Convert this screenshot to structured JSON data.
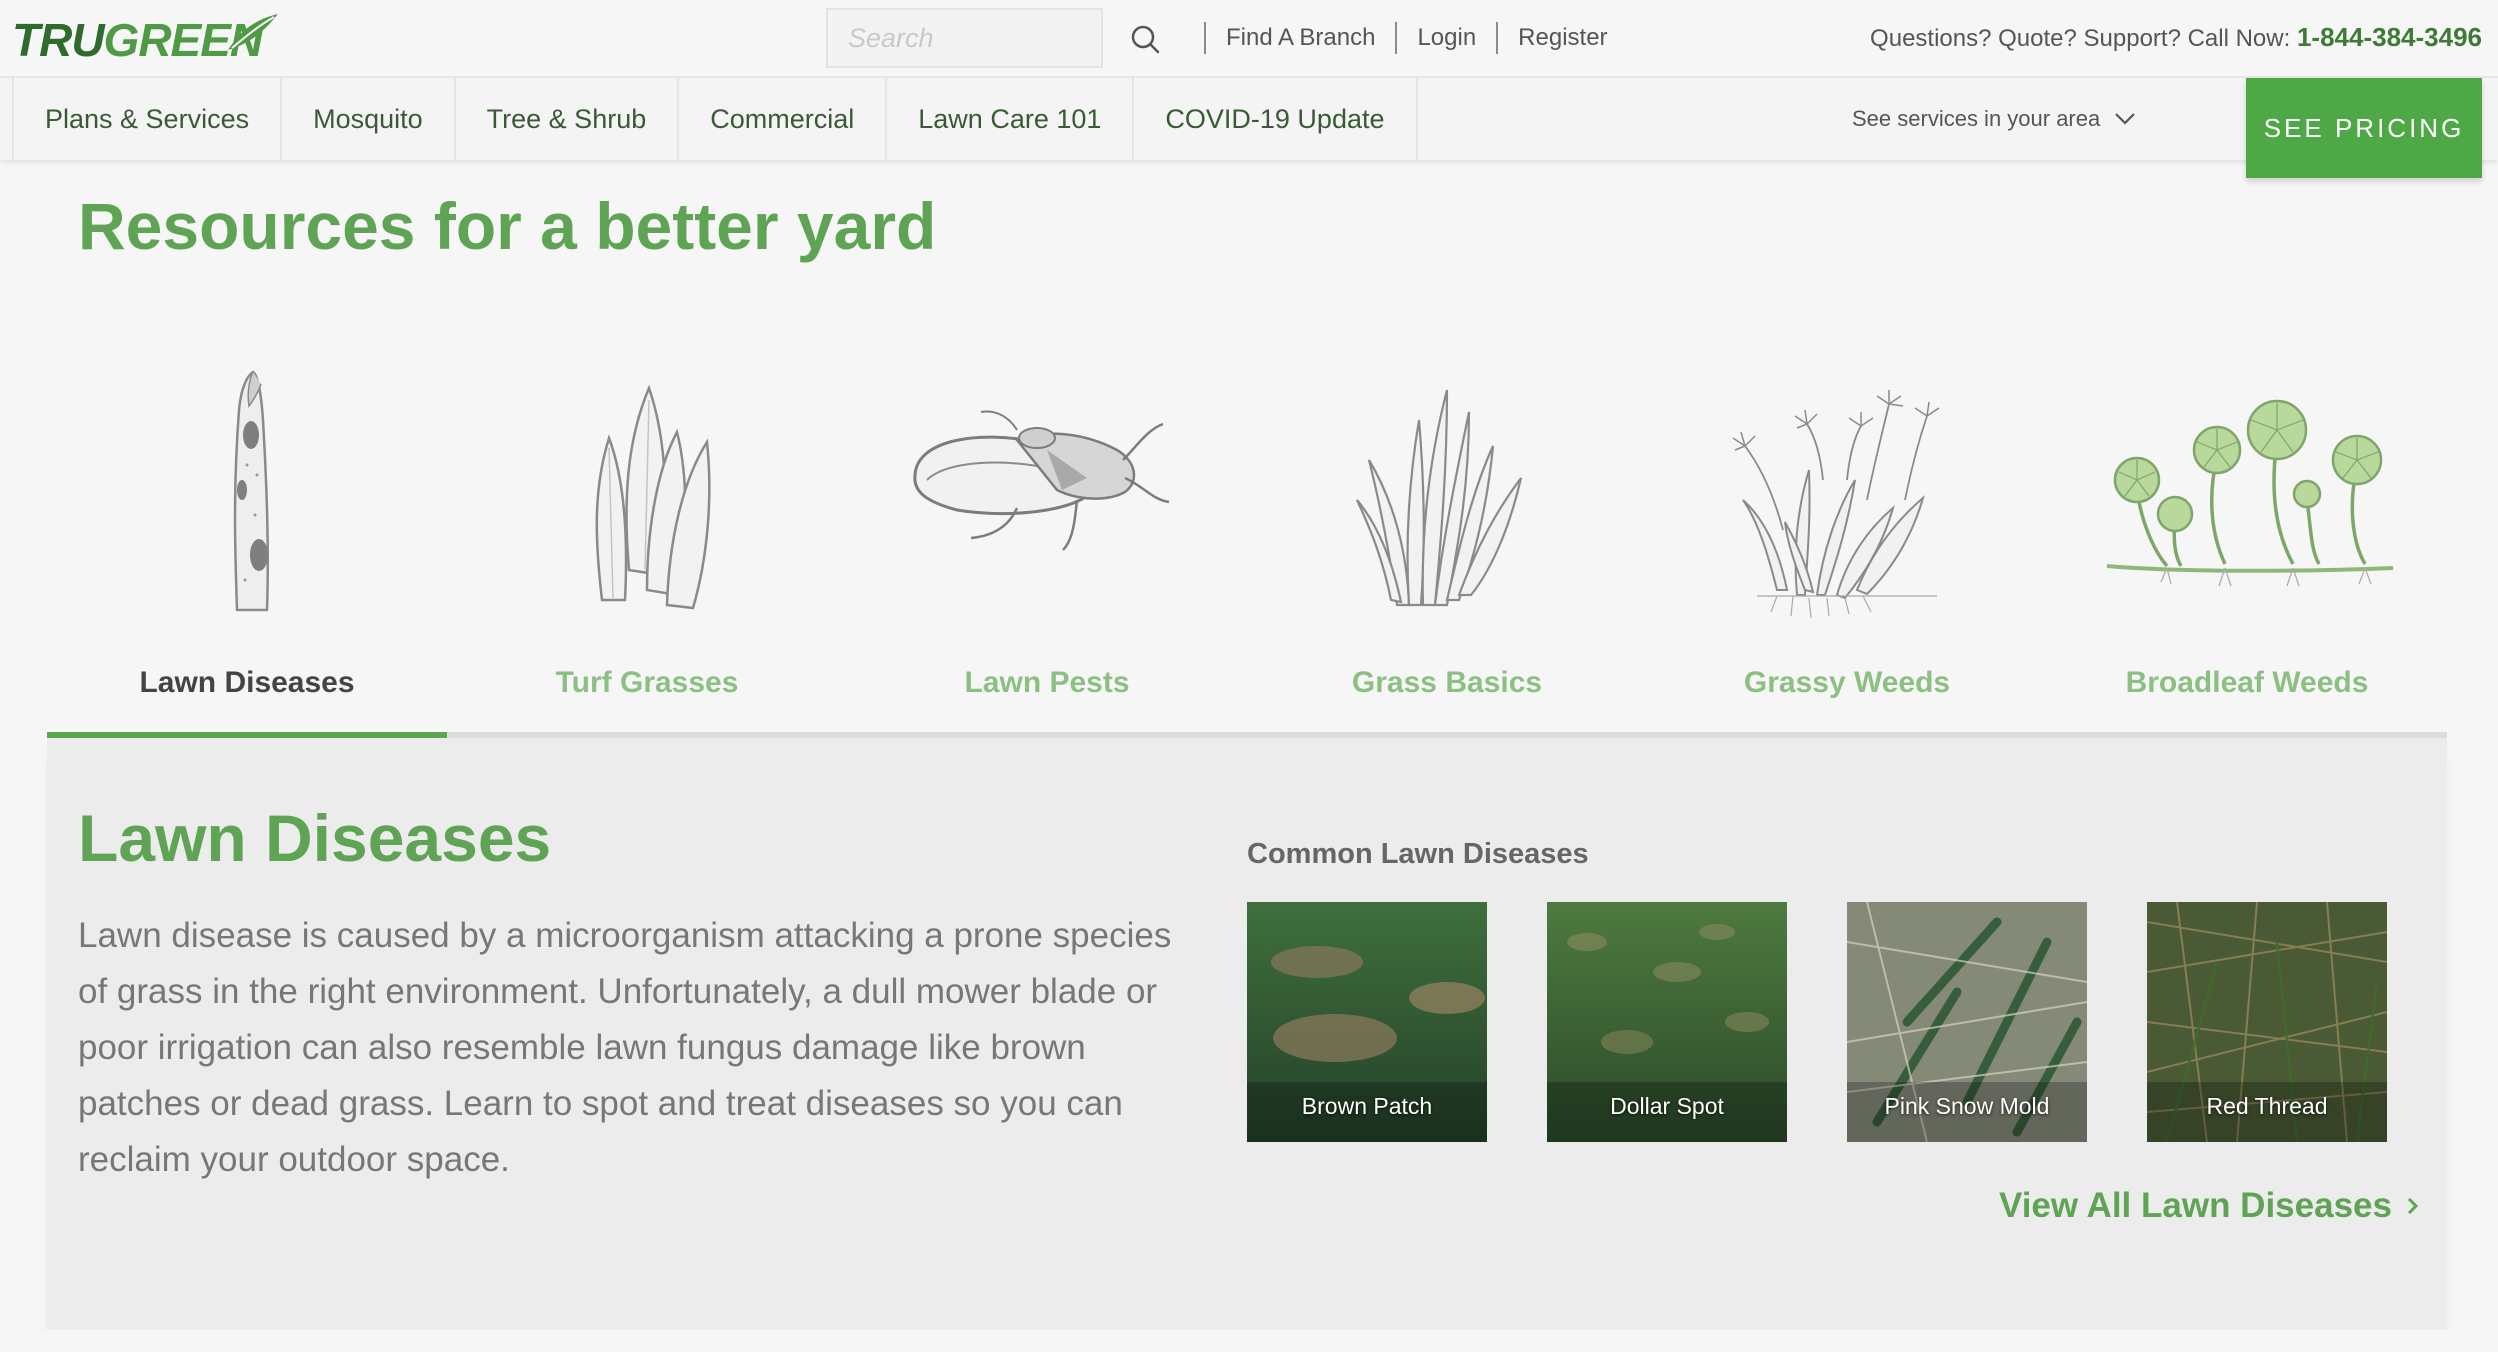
{
  "brand": {
    "logo_part1": "TRU",
    "logo_part2": "GREEN"
  },
  "search": {
    "placeholder": "Search"
  },
  "utility_links": [
    {
      "label": "Find A Branch"
    },
    {
      "label": "Login"
    },
    {
      "label": "Register"
    }
  ],
  "contact": {
    "prefix": "Questions? Quote? Support? Call Now:",
    "phone": "1-844-384-3496"
  },
  "nav": {
    "items": [
      {
        "label": "Plans & Services"
      },
      {
        "label": "Mosquito"
      },
      {
        "label": "Tree & Shrub"
      },
      {
        "label": "Commercial"
      },
      {
        "label": "Lawn Care 101"
      },
      {
        "label": "COVID-19 Update"
      }
    ],
    "area_label": "See services in your area",
    "cta_label": "SEE PRICING"
  },
  "page_title": "Resources for a better yard",
  "tabs": [
    {
      "label": "Lawn Diseases",
      "icon": "diseased-blade-icon",
      "active": true
    },
    {
      "label": "Turf Grasses",
      "icon": "grass-blades-icon",
      "active": false
    },
    {
      "label": "Lawn Pests",
      "icon": "chinch-bug-icon",
      "active": false
    },
    {
      "label": "Grass Basics",
      "icon": "grass-clump-icon",
      "active": false
    },
    {
      "label": "Grassy Weeds",
      "icon": "grassy-weed-icon",
      "active": false
    },
    {
      "label": "Broadleaf Weeds",
      "icon": "broadleaf-weed-icon",
      "active": false
    }
  ],
  "panel": {
    "title": "Lawn Diseases",
    "description": "Lawn disease is caused by a microorganism attacking a prone species of grass in the right environment. Unfortunately, a dull mower blade or poor irrigation can also resemble lawn fungus damage like brown patches or dead grass. Learn to spot and treat diseases so you can reclaim your outdoor space.",
    "common_title": "Common Lawn Diseases",
    "diseases": [
      {
        "label": "Brown Patch"
      },
      {
        "label": "Dollar Spot"
      },
      {
        "label": "Pink Snow Mold"
      },
      {
        "label": "Red Thread"
      }
    ],
    "view_all_label": "View All Lawn Diseases"
  },
  "colors": {
    "brand_green": "#5fa354",
    "cta_green": "#4ea845",
    "inactive_tab": "#8cbf82",
    "dark_green": "#2f6b2c"
  }
}
